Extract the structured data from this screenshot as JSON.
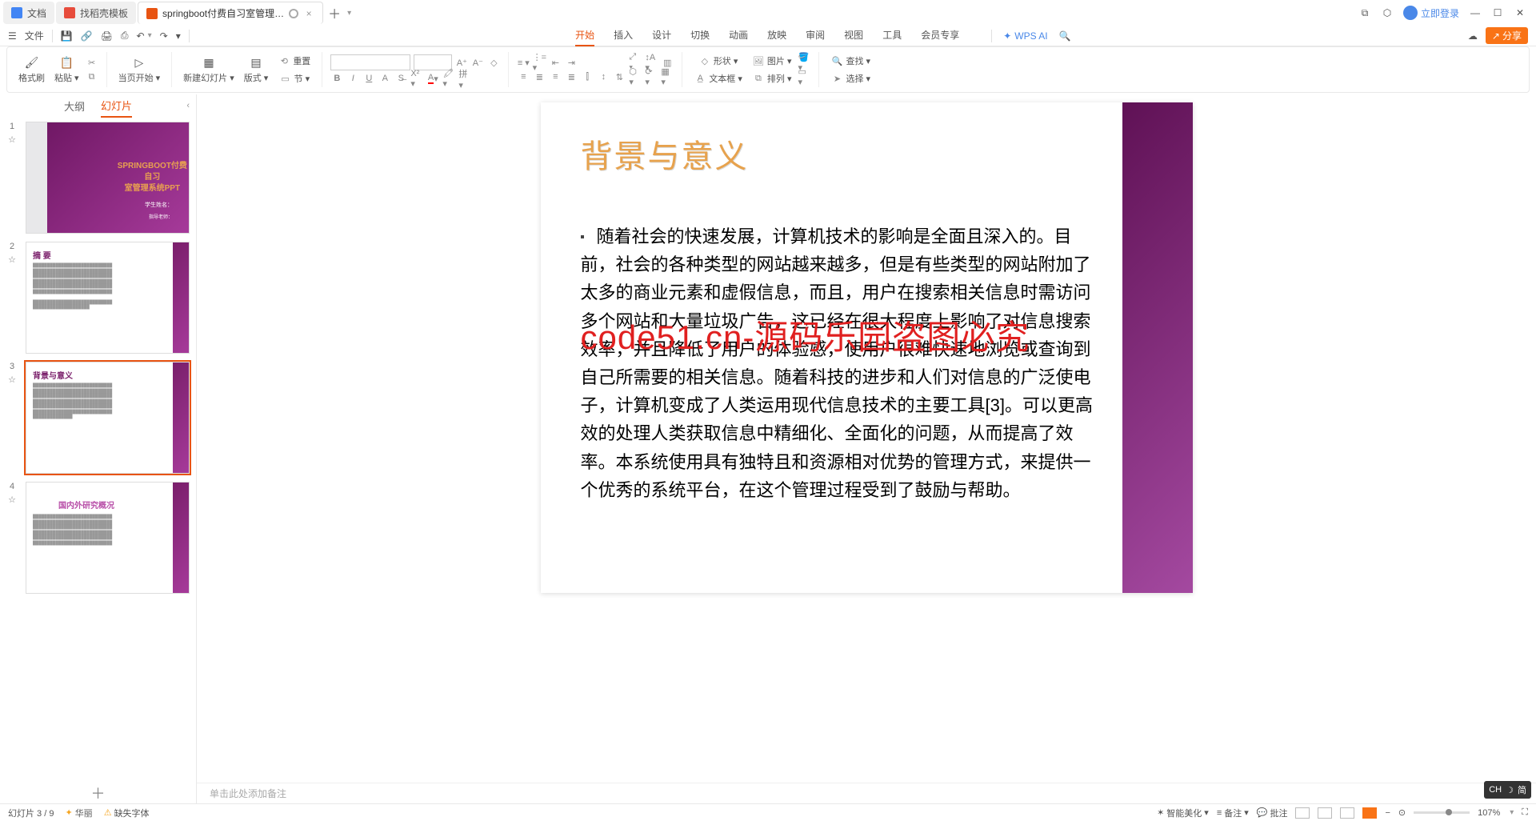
{
  "tabs": [
    {
      "label": "文档",
      "icon": "doc"
    },
    {
      "label": "找稻壳模板",
      "icon": "tpl"
    },
    {
      "label": "springboot付费自习室管理…",
      "icon": "ppt",
      "active": true
    }
  ],
  "login_label": "立即登录",
  "file_menu_label": "文件",
  "menu": {
    "items": [
      "开始",
      "插入",
      "设计",
      "切换",
      "动画",
      "放映",
      "审阅",
      "视图",
      "工具",
      "会员专享"
    ],
    "active": "开始"
  },
  "ai_label": "WPS AI",
  "share_label": "分享",
  "ribbon": {
    "format_brush": "格式刷",
    "paste": "粘贴",
    "copy_icon": "cut",
    "start_page": "当页开始",
    "new_slide": "新建幻灯片",
    "layout": "版式",
    "section": "节",
    "reset_label": "重置",
    "shape": "形状",
    "image": "图片",
    "textbox": "文本框",
    "arrange": "排列",
    "find": "查找",
    "select": "选择"
  },
  "panel": {
    "tabs": [
      "大纲",
      "幻灯片"
    ],
    "active": "幻灯片"
  },
  "slides": [
    {
      "num": "1",
      "title_line1": "SPRINGBOOT付费自习",
      "title_line2": "室管理系统PPT",
      "student_label": "学生姓名：",
      "advisor_label": "指导老师："
    },
    {
      "num": "2",
      "title": "摘 要"
    },
    {
      "num": "3",
      "title": "背景与意义",
      "selected": true
    },
    {
      "num": "4",
      "title": "国内外研究概况"
    }
  ],
  "current_slide": {
    "title": "背景与意义",
    "body": "随着社会的快速发展，计算机技术的影响是全面且深入的。目前，社会的各种类型的网站越来越多，但是有些类型的网站附加了太多的商业元素和虚假信息，而且，用户在搜索相关信息时需访问多个网站和大量垃圾广告，这已经在很大程度上影响了对信息搜索效率，并且降低了用户的体验感，使用户很难快速地浏览或查询到自己所需要的相关信息。随着科技的进步和人们对信息的广泛使电子，计算机变成了人类运用现代信息技术的主要工具[3]。可以更高效的处理人类获取信息中精细化、全面化的问题，从而提高了效率。本系统使用具有独特且和资源相对优势的管理方式，来提供一个优秀的系统平台，在这个管理过程受到了鼓励与帮助。"
  },
  "watermark": "code51.cn-源码乐园盗图必究",
  "notes_placeholder": "单击此处添加备注",
  "status": {
    "slide_counter": "幻灯片 3 / 9",
    "theme": "华丽",
    "missing_font": "缺失字体",
    "smart_beautify": "智能美化",
    "notes_btn": "备注",
    "comment_btn": "批注",
    "zoom": "107%"
  },
  "ime": {
    "lang": "CH",
    "mode": "简"
  }
}
